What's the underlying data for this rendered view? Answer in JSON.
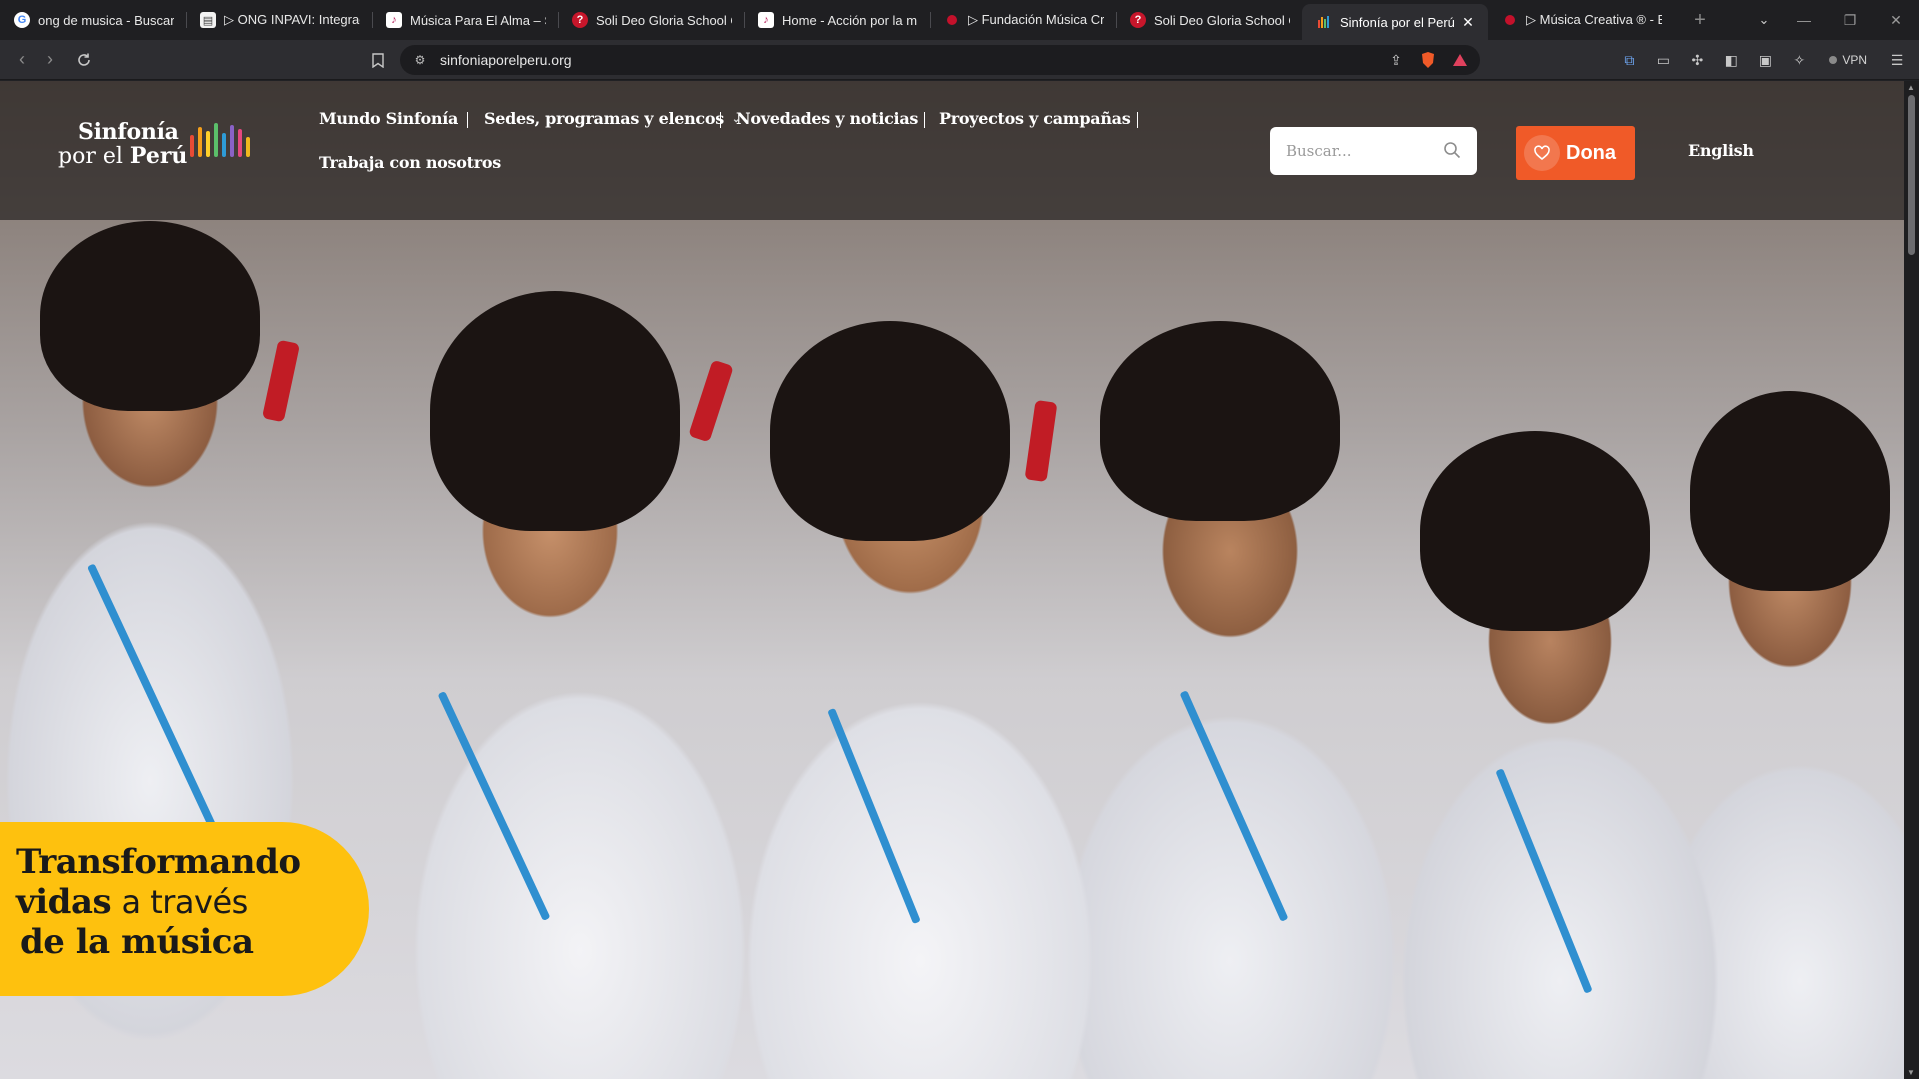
{
  "browser": {
    "tabs": [
      {
        "title": "ong de musica - Buscar co",
        "favicon": "google-icon"
      },
      {
        "title": "▷ ONG INPAVI: Integració",
        "favicon": "page-icon"
      },
      {
        "title": "Música Para El Alma – Sol",
        "favicon": "note-icon"
      },
      {
        "title": "Soli Deo Gloria School Of",
        "favicon": "sdg-icon"
      },
      {
        "title": "Home - Acción por la mú",
        "favicon": "note-icon"
      },
      {
        "title": "▷ Fundación Música Crea",
        "favicon": "red-dot-icon"
      },
      {
        "title": "Soli Deo Gloria School Of",
        "favicon": "sdg-icon"
      },
      {
        "title": "Sinfonía por el Perú |",
        "favicon": "bars-icon",
        "active": true
      },
      {
        "title": "▷ Música Creativa ® - Esc",
        "favicon": "red-dot-icon"
      }
    ],
    "url": "sinfoniaporelperu.org",
    "vpn_label": "VPN"
  },
  "site": {
    "logo_line1": "Sinfonía",
    "logo_line2_a": "por el ",
    "logo_line2_b": "Perú",
    "logo_bar_colors": [
      "#e94b35",
      "#f59f1b",
      "#ffd02a",
      "#5bbf6a",
      "#2e9bd6",
      "#8a62c6",
      "#e5487e",
      "#f0b71e"
    ],
    "nav": [
      {
        "label": "Mundo Sinfonía"
      },
      {
        "label": "Sedes, programas y elencos",
        "has_dropdown": true
      },
      {
        "label": "Novedades y noticias"
      },
      {
        "label": "Proyectos y campañas"
      },
      {
        "label": "Trabaja con nosotros"
      }
    ],
    "search_placeholder": "Buscar...",
    "donate_label": "Dona",
    "language_link": "English",
    "hero": {
      "line1": "Transformando",
      "line2_bold": "vidas",
      "line2_light": "a través",
      "line3": "de la música",
      "badge_color": "#fec10e"
    },
    "accent_color": "#f05a28"
  }
}
